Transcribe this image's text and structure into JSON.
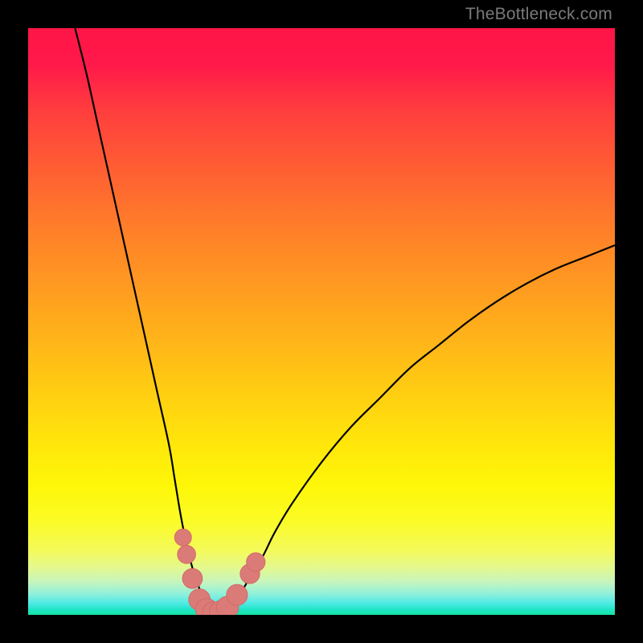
{
  "watermark_text": "TheBottleneck.com",
  "colors": {
    "page_bg": "#000000",
    "curve_stroke": "#000000",
    "marker_fill": "#db7b78",
    "marker_stroke": "#d46a66",
    "watermark": "#7a7a7a"
  },
  "chart_data": {
    "type": "line",
    "title": "",
    "xlabel": "",
    "ylabel": "",
    "xlim": [
      0,
      100
    ],
    "ylim": [
      0,
      100
    ],
    "grid": false,
    "series": [
      {
        "name": "left-branch",
        "x": [
          8,
          10,
          12,
          14,
          16,
          18,
          20,
          22,
          24,
          25,
          26,
          27,
          28,
          29,
          30,
          31,
          32
        ],
        "y": [
          100,
          92,
          83,
          74,
          65,
          56,
          47,
          38,
          29,
          23,
          17,
          12,
          8,
          5,
          2.5,
          1,
          0
        ]
      },
      {
        "name": "right-branch",
        "x": [
          32,
          33,
          34,
          35,
          36,
          37,
          38,
          40,
          42,
          45,
          50,
          55,
          60,
          65,
          70,
          75,
          80,
          85,
          90,
          95,
          100
        ],
        "y": [
          0,
          0.3,
          1,
          2,
          3.5,
          5,
          7,
          10,
          14,
          19,
          26,
          32,
          37,
          42,
          46,
          50,
          53.5,
          56.5,
          59,
          61,
          63
        ]
      }
    ],
    "markers": {
      "name": "highlight-region",
      "points": [
        {
          "x": 26.4,
          "y": 13.2
        },
        {
          "x": 27.0,
          "y": 10.3
        },
        {
          "x": 28.0,
          "y": 6.2
        },
        {
          "x": 29.2,
          "y": 2.6
        },
        {
          "x": 30.4,
          "y": 0.9
        },
        {
          "x": 31.6,
          "y": 0.3
        },
        {
          "x": 32.8,
          "y": 0.5
        },
        {
          "x": 34.0,
          "y": 1.3
        },
        {
          "x": 35.6,
          "y": 3.4
        },
        {
          "x": 37.8,
          "y": 7.0
        },
        {
          "x": 38.8,
          "y": 9.0
        }
      ]
    }
  }
}
